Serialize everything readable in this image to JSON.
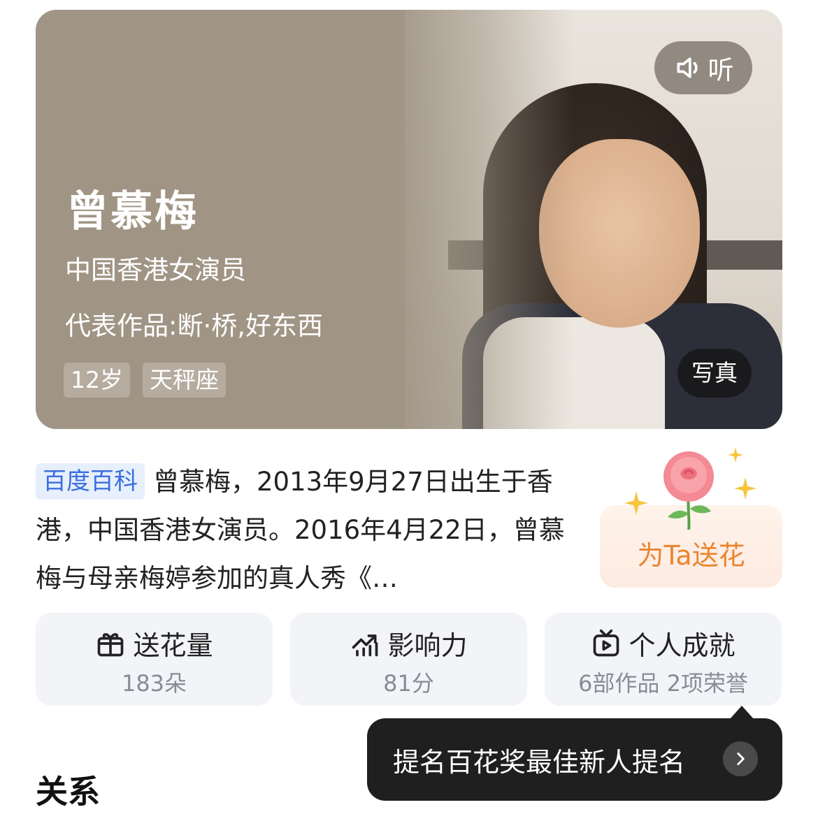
{
  "hero": {
    "name": "曾慕梅",
    "role": "中国香港女演员",
    "works": "代表作品:断·桥,好东西",
    "tags": [
      "12岁",
      "天秤座"
    ],
    "listen_label": "听",
    "photo_label": "写真"
  },
  "intro": {
    "source_badge": "百度百科",
    "text": "曾慕梅，2013年9月27日出生于香港，中国香港女演员。2016年4月22日，曾慕梅与母亲梅婷参加的真人秀《…"
  },
  "flower": {
    "button_label": "为Ta送花"
  },
  "stats": [
    {
      "title": "送花量",
      "value": "183朵",
      "icon": "gift-icon"
    },
    {
      "title": "影响力",
      "value": "81分",
      "icon": "trend-chart-icon"
    },
    {
      "title": "个人成就",
      "value": "6部作品 2项荣誉",
      "icon": "tv-play-icon"
    }
  ],
  "tooltip": {
    "text": "提名百花奖最佳新人提名"
  },
  "section": {
    "title": "关系"
  },
  "colors": {
    "accent_blue": "#3a6fe0",
    "flower_orange": "#e98530",
    "stat_bg": "#f2f4f8",
    "tooltip_bg": "#1f1f1f"
  }
}
